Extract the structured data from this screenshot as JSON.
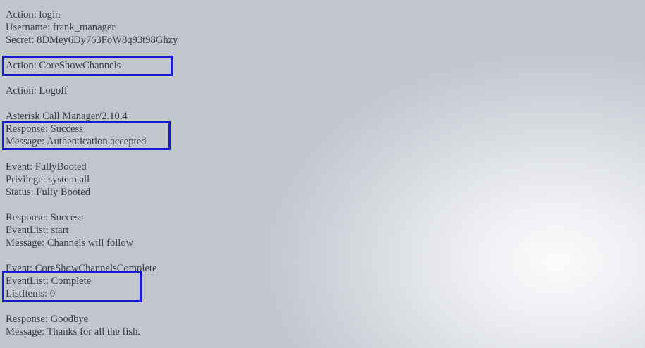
{
  "blocks": [
    [
      "Action: login",
      "Username: frank_manager",
      "Secret: 8DMey6Dy763FoW8q93t98Ghzy"
    ],
    [
      "Action: CoreShowChannels"
    ],
    [
      "Action: Logoff"
    ],
    [
      "Asterisk Call Manager/2.10.4",
      "Response: Success",
      "Message: Authentication accepted"
    ],
    [
      "Event: FullyBooted",
      "Privilege: system,all",
      "Status: Fully Booted"
    ],
    [
      "Response: Success",
      "EventList: start",
      "Message: Channels will follow"
    ],
    [
      "Event: CoreShowChannelsComplete",
      "EventList: Complete",
      "ListItems: 0"
    ],
    [
      "Response: Goodbye",
      "Message: Thanks for all the fish."
    ]
  ],
  "highlight_color": "#1a1ad6"
}
